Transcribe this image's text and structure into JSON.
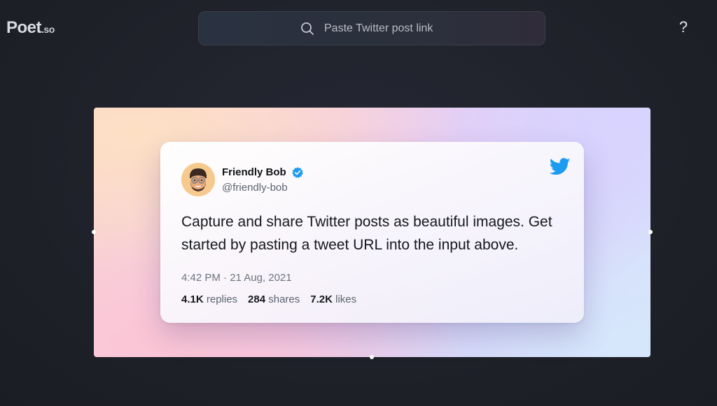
{
  "header": {
    "logo_main": "Poet",
    "logo_suffix": ".so",
    "search_placeholder": "Paste Twitter post link",
    "help_label": "?"
  },
  "tweet": {
    "author_name": "Friendly Bob",
    "author_handle": "@friendly-bob",
    "text": "Capture and share Twitter posts as beautiful images. Get started by pasting a tweet URL into the input above.",
    "timestamp": "4:42 PM · 21 Aug, 2021",
    "stats": {
      "replies_count": "4.1K",
      "replies_label": "replies",
      "shares_count": "284",
      "shares_label": "shares",
      "likes_count": "7.2K",
      "likes_label": "likes"
    }
  },
  "colors": {
    "background": "#1f222b",
    "twitter_blue": "#1d9bf0",
    "verified_blue": "#1d9bf0"
  },
  "icons": [
    "search-icon",
    "help-icon",
    "avatar",
    "verified-badge-icon",
    "twitter-bird-icon"
  ]
}
